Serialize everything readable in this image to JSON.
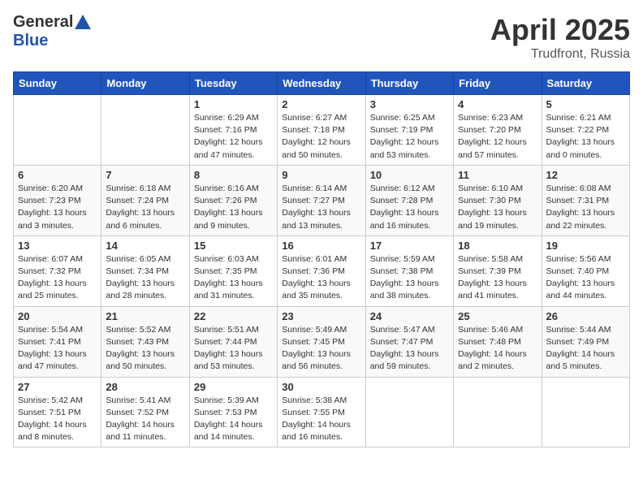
{
  "header": {
    "logo_general": "General",
    "logo_blue": "Blue",
    "title": "April 2025",
    "location": "Trudfront, Russia"
  },
  "weekdays": [
    "Sunday",
    "Monday",
    "Tuesday",
    "Wednesday",
    "Thursday",
    "Friday",
    "Saturday"
  ],
  "weeks": [
    [
      {
        "day": "",
        "info": ""
      },
      {
        "day": "",
        "info": ""
      },
      {
        "day": "1",
        "info": "Sunrise: 6:29 AM\nSunset: 7:16 PM\nDaylight: 12 hours and 47 minutes."
      },
      {
        "day": "2",
        "info": "Sunrise: 6:27 AM\nSunset: 7:18 PM\nDaylight: 12 hours and 50 minutes."
      },
      {
        "day": "3",
        "info": "Sunrise: 6:25 AM\nSunset: 7:19 PM\nDaylight: 12 hours and 53 minutes."
      },
      {
        "day": "4",
        "info": "Sunrise: 6:23 AM\nSunset: 7:20 PM\nDaylight: 12 hours and 57 minutes."
      },
      {
        "day": "5",
        "info": "Sunrise: 6:21 AM\nSunset: 7:22 PM\nDaylight: 13 hours and 0 minutes."
      }
    ],
    [
      {
        "day": "6",
        "info": "Sunrise: 6:20 AM\nSunset: 7:23 PM\nDaylight: 13 hours and 3 minutes."
      },
      {
        "day": "7",
        "info": "Sunrise: 6:18 AM\nSunset: 7:24 PM\nDaylight: 13 hours and 6 minutes."
      },
      {
        "day": "8",
        "info": "Sunrise: 6:16 AM\nSunset: 7:26 PM\nDaylight: 13 hours and 9 minutes."
      },
      {
        "day": "9",
        "info": "Sunrise: 6:14 AM\nSunset: 7:27 PM\nDaylight: 13 hours and 13 minutes."
      },
      {
        "day": "10",
        "info": "Sunrise: 6:12 AM\nSunset: 7:28 PM\nDaylight: 13 hours and 16 minutes."
      },
      {
        "day": "11",
        "info": "Sunrise: 6:10 AM\nSunset: 7:30 PM\nDaylight: 13 hours and 19 minutes."
      },
      {
        "day": "12",
        "info": "Sunrise: 6:08 AM\nSunset: 7:31 PM\nDaylight: 13 hours and 22 minutes."
      }
    ],
    [
      {
        "day": "13",
        "info": "Sunrise: 6:07 AM\nSunset: 7:32 PM\nDaylight: 13 hours and 25 minutes."
      },
      {
        "day": "14",
        "info": "Sunrise: 6:05 AM\nSunset: 7:34 PM\nDaylight: 13 hours and 28 minutes."
      },
      {
        "day": "15",
        "info": "Sunrise: 6:03 AM\nSunset: 7:35 PM\nDaylight: 13 hours and 31 minutes."
      },
      {
        "day": "16",
        "info": "Sunrise: 6:01 AM\nSunset: 7:36 PM\nDaylight: 13 hours and 35 minutes."
      },
      {
        "day": "17",
        "info": "Sunrise: 5:59 AM\nSunset: 7:38 PM\nDaylight: 13 hours and 38 minutes."
      },
      {
        "day": "18",
        "info": "Sunrise: 5:58 AM\nSunset: 7:39 PM\nDaylight: 13 hours and 41 minutes."
      },
      {
        "day": "19",
        "info": "Sunrise: 5:56 AM\nSunset: 7:40 PM\nDaylight: 13 hours and 44 minutes."
      }
    ],
    [
      {
        "day": "20",
        "info": "Sunrise: 5:54 AM\nSunset: 7:41 PM\nDaylight: 13 hours and 47 minutes."
      },
      {
        "day": "21",
        "info": "Sunrise: 5:52 AM\nSunset: 7:43 PM\nDaylight: 13 hours and 50 minutes."
      },
      {
        "day": "22",
        "info": "Sunrise: 5:51 AM\nSunset: 7:44 PM\nDaylight: 13 hours and 53 minutes."
      },
      {
        "day": "23",
        "info": "Sunrise: 5:49 AM\nSunset: 7:45 PM\nDaylight: 13 hours and 56 minutes."
      },
      {
        "day": "24",
        "info": "Sunrise: 5:47 AM\nSunset: 7:47 PM\nDaylight: 13 hours and 59 minutes."
      },
      {
        "day": "25",
        "info": "Sunrise: 5:46 AM\nSunset: 7:48 PM\nDaylight: 14 hours and 2 minutes."
      },
      {
        "day": "26",
        "info": "Sunrise: 5:44 AM\nSunset: 7:49 PM\nDaylight: 14 hours and 5 minutes."
      }
    ],
    [
      {
        "day": "27",
        "info": "Sunrise: 5:42 AM\nSunset: 7:51 PM\nDaylight: 14 hours and 8 minutes."
      },
      {
        "day": "28",
        "info": "Sunrise: 5:41 AM\nSunset: 7:52 PM\nDaylight: 14 hours and 11 minutes."
      },
      {
        "day": "29",
        "info": "Sunrise: 5:39 AM\nSunset: 7:53 PM\nDaylight: 14 hours and 14 minutes."
      },
      {
        "day": "30",
        "info": "Sunrise: 5:38 AM\nSunset: 7:55 PM\nDaylight: 14 hours and 16 minutes."
      },
      {
        "day": "",
        "info": ""
      },
      {
        "day": "",
        "info": ""
      },
      {
        "day": "",
        "info": ""
      }
    ]
  ]
}
